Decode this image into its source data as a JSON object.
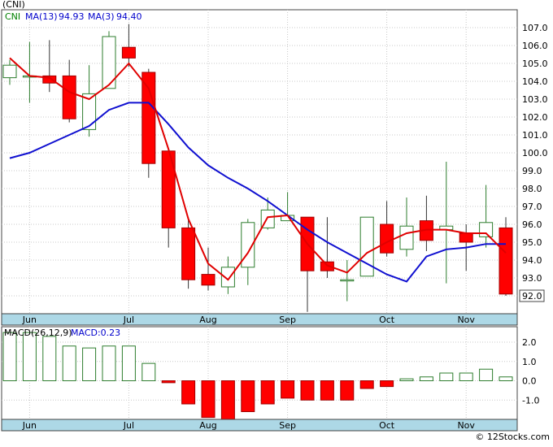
{
  "chart_data": [
    {
      "type": "candlestick",
      "ticker": "(CNI)",
      "legend": [
        {
          "label": "CNI",
          "color": "#008000"
        },
        {
          "label": "MA(13)",
          "value": "94.93",
          "color": "#0000cc"
        },
        {
          "label": "MA(3)",
          "value": "94.40",
          "color": "#0000cc"
        }
      ],
      "ylim": [
        91,
        108
      ],
      "y_ticks": [
        "107.0",
        "106.0",
        "105.0",
        "104.0",
        "103.0",
        "102.0",
        "101.0",
        "100.0",
        "99.0",
        "98.0",
        "97.0",
        "96.0",
        "95.0",
        "94.0",
        "93.0",
        "92.0"
      ],
      "last_price_label": "92.0",
      "x_labels": [
        "Jun",
        "Jul",
        "Aug",
        "Sep",
        "Oct",
        "Nov"
      ],
      "x_label_index": [
        1,
        6,
        10,
        14,
        19,
        23
      ],
      "candles": [
        {
          "o": 104.2,
          "h": 105.2,
          "l": 103.8,
          "c": 104.9
        },
        {
          "o": 104.3,
          "h": 106.2,
          "l": 102.8,
          "c": 104.3
        },
        {
          "o": 104.3,
          "h": 106.3,
          "l": 103.4,
          "c": 103.9
        },
        {
          "o": 104.3,
          "h": 105.2,
          "l": 101.7,
          "c": 101.9
        },
        {
          "o": 101.3,
          "h": 104.9,
          "l": 100.9,
          "c": 103.3
        },
        {
          "o": 103.6,
          "h": 106.8,
          "l": 103.6,
          "c": 106.5
        },
        {
          "o": 105.9,
          "h": 107.2,
          "l": 104.8,
          "c": 105.3
        },
        {
          "o": 104.5,
          "h": 104.7,
          "l": 98.6,
          "c": 99.4
        },
        {
          "o": 100.1,
          "h": 100.1,
          "l": 94.7,
          "c": 95.8
        },
        {
          "o": 95.8,
          "h": 96.4,
          "l": 92.4,
          "c": 92.9
        },
        {
          "o": 93.2,
          "h": 94.7,
          "l": 92.3,
          "c": 92.6
        },
        {
          "o": 92.5,
          "h": 94.2,
          "l": 92.1,
          "c": 93.6
        },
        {
          "o": 93.6,
          "h": 96.3,
          "l": 92.6,
          "c": 96.1
        },
        {
          "o": 95.8,
          "h": 97.5,
          "l": 95.7,
          "c": 96.8
        },
        {
          "o": 96.2,
          "h": 97.8,
          "l": 96.2,
          "c": 96.5
        },
        {
          "o": 96.4,
          "h": 96.4,
          "l": 91.1,
          "c": 93.4
        },
        {
          "o": 93.9,
          "h": 96.4,
          "l": 93.0,
          "c": 93.4
        },
        {
          "o": 92.9,
          "h": 94.0,
          "l": 91.7,
          "c": 92.9
        },
        {
          "o": 93.1,
          "h": 96.4,
          "l": 93.1,
          "c": 96.4
        },
        {
          "o": 96.0,
          "h": 97.3,
          "l": 94.2,
          "c": 94.4
        },
        {
          "o": 94.6,
          "h": 97.5,
          "l": 94.2,
          "c": 95.9
        },
        {
          "o": 96.2,
          "h": 97.6,
          "l": 94.5,
          "c": 95.1
        },
        {
          "o": 95.7,
          "h": 99.5,
          "l": 92.7,
          "c": 95.9
        },
        {
          "o": 95.5,
          "h": 96.0,
          "l": 93.4,
          "c": 95.0
        },
        {
          "o": 95.3,
          "h": 98.2,
          "l": 94.7,
          "c": 96.1
        },
        {
          "o": 95.8,
          "h": 96.4,
          "l": 92.0,
          "c": 92.1
        }
      ],
      "ma_red": [
        105.3,
        104.3,
        104.2,
        103.4,
        103.0,
        103.8,
        105.0,
        103.6,
        100.2,
        96.3,
        93.8,
        92.9,
        94.4,
        96.4,
        96.5,
        94.9,
        93.7,
        93.3,
        94.4,
        95.0,
        95.5,
        95.7,
        95.7,
        95.5,
        95.5,
        94.4
      ],
      "ma_blue": [
        null,
        null,
        null,
        null,
        null,
        null,
        null,
        null,
        null,
        null,
        null,
        null,
        null,
        null,
        null,
        null,
        null,
        null,
        null,
        null,
        null,
        null,
        null,
        null,
        null,
        null
      ],
      "ma_blue_full": [
        99.7,
        100.0,
        100.5,
        101.0,
        101.5,
        102.4,
        102.8,
        102.8,
        101.6,
        100.3,
        99.3,
        98.6,
        98.0,
        97.3,
        96.5,
        95.7,
        95.0,
        94.4,
        93.8,
        93.2,
        92.8,
        94.2,
        94.6,
        94.7,
        94.9,
        94.9
      ]
    },
    {
      "type": "bar",
      "legend": [
        {
          "label": "MACD(26,12,9)",
          "color": "#000000"
        },
        {
          "label": "MACD:0.23",
          "color": "#0000cc"
        }
      ],
      "ylim": [
        -2.0,
        2.8
      ],
      "y_ticks": [
        {
          "label": "2.0",
          "v": 2.0
        },
        {
          "label": "1.0",
          "v": 1.0
        },
        {
          "label": "0.0",
          "v": 0.0
        },
        {
          "label": "-1.0",
          "v": -1.0
        }
      ],
      "x_labels": [
        "Jun",
        "Jul",
        "Aug",
        "Sep",
        "Oct",
        "Nov"
      ],
      "values": [
        2.5,
        2.5,
        2.3,
        1.8,
        1.7,
        1.8,
        1.8,
        0.9,
        -0.1,
        -1.2,
        -1.9,
        -2.0,
        -1.6,
        -1.2,
        -0.9,
        -1.0,
        -1.0,
        -1.0,
        -0.4,
        -0.3,
        0.1,
        0.2,
        0.4,
        0.4,
        0.6,
        0.2
      ]
    }
  ],
  "footer": {
    "text": "© 12Stocks.com"
  }
}
